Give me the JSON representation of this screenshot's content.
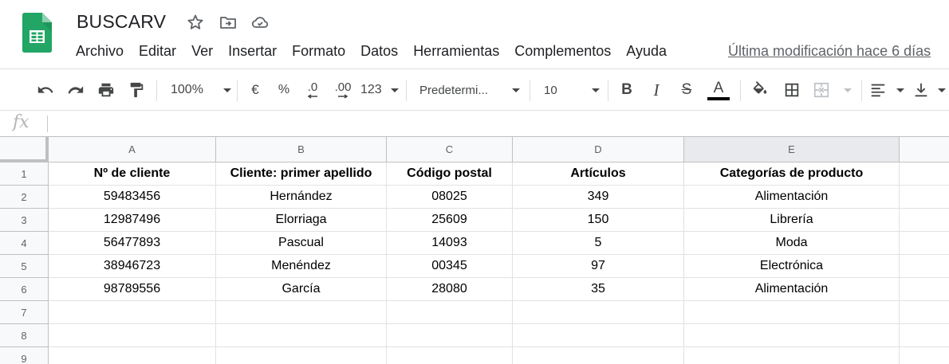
{
  "document": {
    "title": "BUSCARV",
    "last_edit": "Última modificación hace 6 días"
  },
  "menu": [
    "Archivo",
    "Editar",
    "Ver",
    "Insertar",
    "Formato",
    "Datos",
    "Herramientas",
    "Complementos",
    "Ayuda"
  ],
  "toolbar": {
    "zoom": "100%",
    "currency": "€",
    "percent": "%",
    "decrease_decimals": ".0",
    "increase_decimals": ".00",
    "number_format": "123",
    "font": "Predetermi...",
    "font_size": "10",
    "bold": "B",
    "italic": "I",
    "strikethrough": "S",
    "text_color_letter": "A"
  },
  "formula_bar": {
    "icon": "fx",
    "value": ""
  },
  "colors": {
    "sheets_green": "#23a566",
    "header_bg": "#f8f9fa",
    "selected_header_bg": "#e8eaed",
    "gridline": "#e2e2e2"
  },
  "grid": {
    "columns": [
      "A",
      "B",
      "C",
      "D",
      "E"
    ],
    "row_numbers": [
      "1",
      "2",
      "3",
      "4",
      "5",
      "6",
      "7",
      "8",
      "9"
    ],
    "header_row": [
      "Nº de cliente",
      "Cliente: primer apellido",
      "Código postal",
      "Artículos",
      "Categorías de producto"
    ],
    "rows": [
      [
        "59483456",
        "Hernández",
        "08025",
        "349",
        "Alimentación"
      ],
      [
        "12987496",
        "Elorriaga",
        "25609",
        "150",
        "Librería"
      ],
      [
        "56477893",
        "Pascual",
        "14093",
        "5",
        "Moda"
      ],
      [
        "38946723",
        "Menéndez",
        "00345",
        "97",
        "Electrónica"
      ],
      [
        "98789556",
        "García",
        "28080",
        "35",
        "Alimentación"
      ],
      [
        "",
        "",
        "",
        "",
        ""
      ],
      [
        "",
        "",
        "",
        "",
        ""
      ],
      [
        "",
        "",
        "",
        "",
        ""
      ]
    ]
  }
}
